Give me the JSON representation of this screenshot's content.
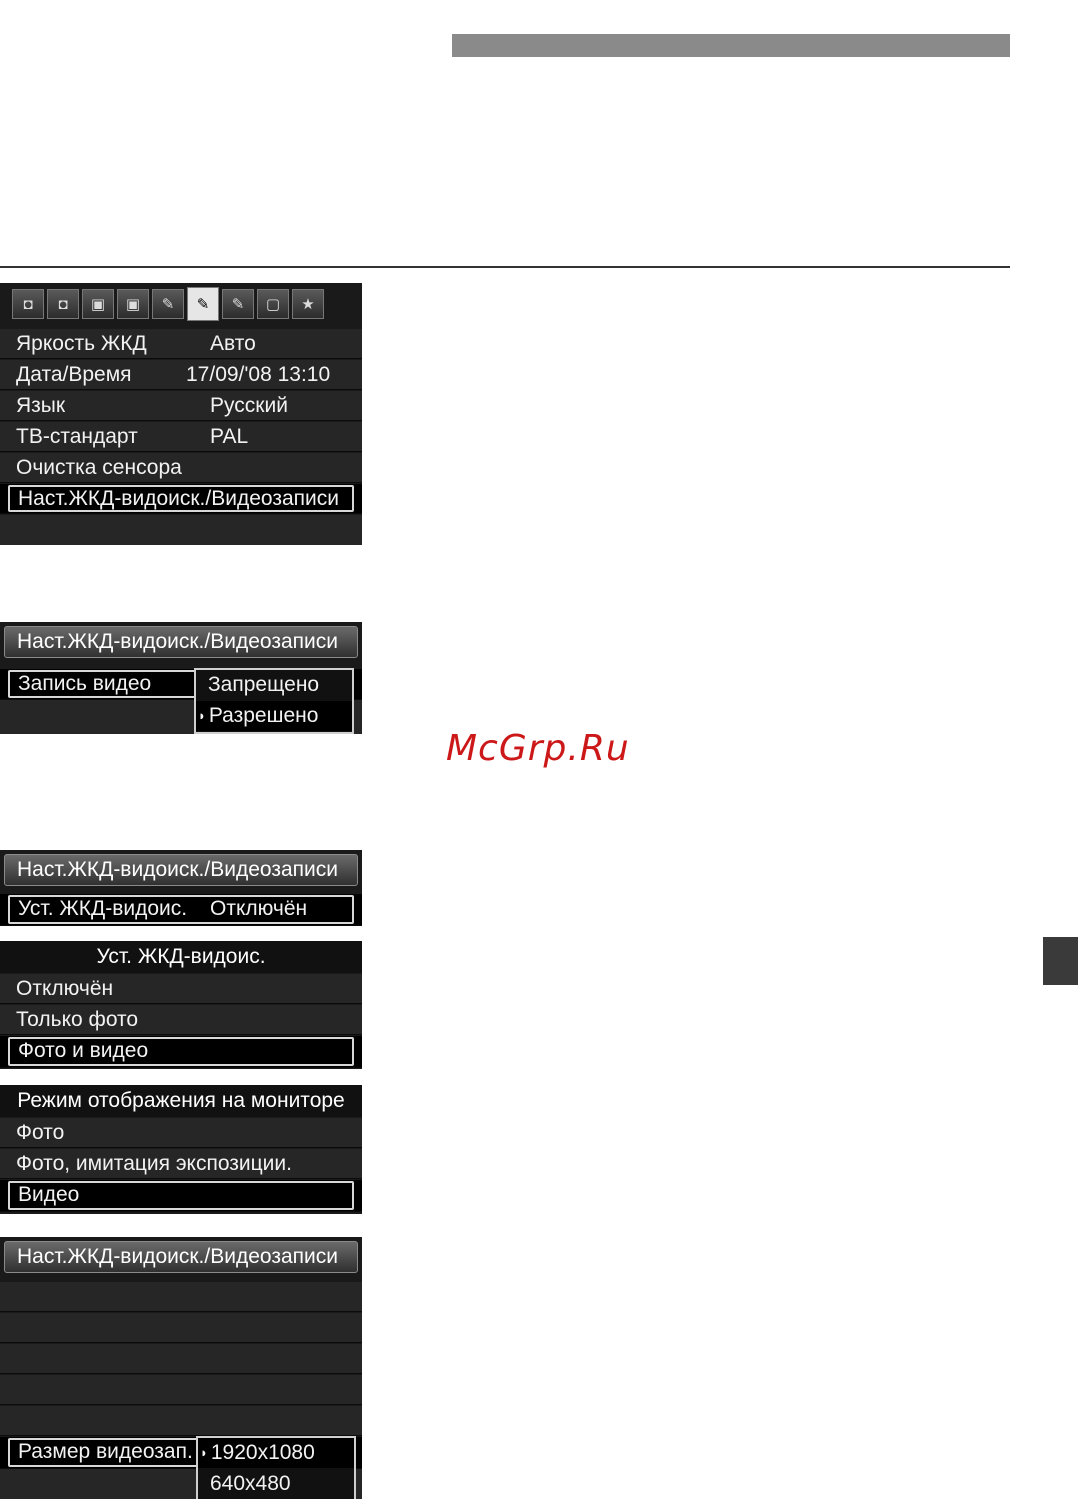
{
  "watermark": "McGrp.Ru",
  "screen1": {
    "tab_icons": [
      "camera-1-icon",
      "camera-2-icon",
      "playback-1-icon",
      "playback-2-icon",
      "setup-1-icon",
      "setup-2-icon",
      "setup-3-icon",
      "custom-function-icon",
      "my-menu-icon"
    ],
    "tab_glyphs": [
      "◘",
      "◘",
      "▣",
      "▣",
      "✎",
      "✎",
      "✎",
      "▢",
      "★"
    ],
    "rows": [
      {
        "label": "Яркость ЖКД",
        "value": "Авто"
      },
      {
        "label": "Дата/Время",
        "value": "17/09/'08 13:10"
      },
      {
        "label": "Язык",
        "value": "Русский"
      },
      {
        "label": "ТВ-стандарт",
        "value": "PAL"
      },
      {
        "label": "Очистка сенсора",
        "value": ""
      },
      {
        "label": "Наст.ЖКД-видоиск./Видеозаписи",
        "value": ""
      }
    ]
  },
  "screen2": {
    "header": "Наст.ЖКД-видоиск./Видеозаписи",
    "row_label": "Запись видео",
    "options": [
      "Запрещено",
      "Разрешено"
    ],
    "arrow": "◗"
  },
  "screen3": {
    "header": "Наст.ЖКД-видоиск./Видеозаписи",
    "row_label": "Уст. ЖКД-видоис.",
    "row_value": "Отключён"
  },
  "screen4": {
    "title": "Уст. ЖКД-видоис.",
    "items": [
      "Отключён",
      "Только фото",
      "Фото и видео"
    ]
  },
  "screen5": {
    "title": "Режим отображения на мониторе",
    "items": [
      "Фото",
      "Фото, имитация экспозиции.",
      "Видео"
    ]
  },
  "screen6": {
    "header": "Наст.ЖКД-видоиск./Видеозаписи",
    "row_label": "Размер видеозап.",
    "options": [
      "1920x1080",
      "640x480"
    ],
    "arrow": "◗"
  }
}
